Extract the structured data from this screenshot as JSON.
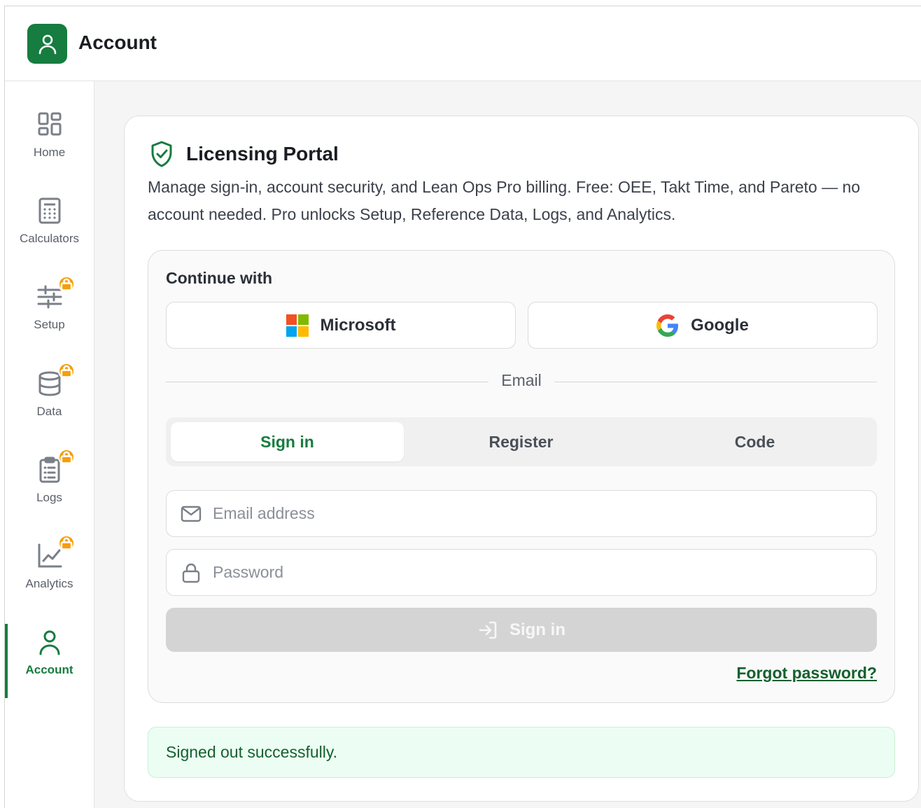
{
  "header": {
    "title": "Account",
    "logo_icon": "user-icon",
    "brand_color": "#167c3f"
  },
  "sidebar": {
    "items": [
      {
        "label": "Home",
        "icon": "grid-icon",
        "locked": false,
        "active": false
      },
      {
        "label": "Calculators",
        "icon": "calculator-icon",
        "locked": false,
        "active": false
      },
      {
        "label": "Setup",
        "icon": "sliders-icon",
        "locked": true,
        "active": false
      },
      {
        "label": "Data",
        "icon": "database-icon",
        "locked": true,
        "active": false
      },
      {
        "label": "Logs",
        "icon": "clipboard-icon",
        "locked": true,
        "active": false
      },
      {
        "label": "Analytics",
        "icon": "chart-icon",
        "locked": true,
        "active": false
      },
      {
        "label": "Account",
        "icon": "user-icon",
        "locked": false,
        "active": true
      }
    ],
    "lock_color": "#f59e0b"
  },
  "portal": {
    "title": "Licensing Portal",
    "description": "Manage sign-in, account security, and Lean Ops Pro billing. Free: OEE, Takt Time, and Pareto — no account needed. Pro unlocks Setup, Reference Data, Logs, and Analytics."
  },
  "auth": {
    "continue_label": "Continue with",
    "microsoft_label": "Microsoft",
    "google_label": "Google",
    "divider_label": "Email",
    "tabs": [
      {
        "label": "Sign in",
        "active": true
      },
      {
        "label": "Register",
        "active": false
      },
      {
        "label": "Code",
        "active": false
      }
    ],
    "email_placeholder": "Email address",
    "password_placeholder": "Password",
    "submit_label": "Sign in",
    "forgot_label": "Forgot password?"
  },
  "alert": {
    "message": "Signed out successfully.",
    "status_color": "#15602f"
  }
}
